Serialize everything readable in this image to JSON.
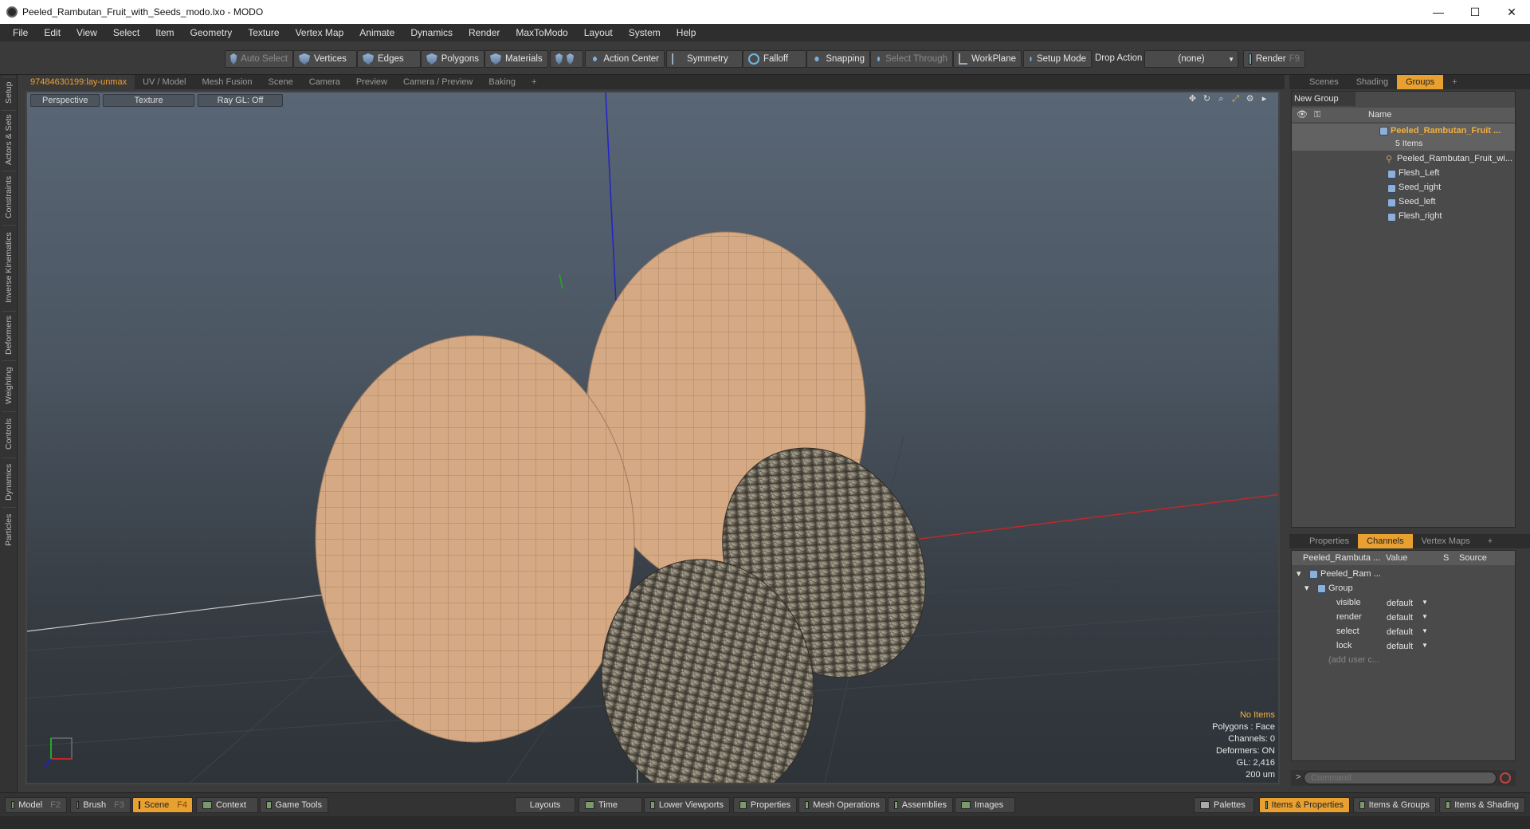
{
  "window": {
    "title": "Peeled_Rambutan_Fruit_with_Seeds_modo.lxo - MODO",
    "minimize": "—",
    "maximize": "☐",
    "close": "✕"
  },
  "menu": [
    "File",
    "Edit",
    "View",
    "Select",
    "Item",
    "Geometry",
    "Texture",
    "Vertex Map",
    "Animate",
    "Dynamics",
    "Render",
    "MaxToModo",
    "Layout",
    "System",
    "Help"
  ],
  "toolbar": {
    "auto_select": "Auto Select",
    "vertices": "Vertices",
    "edges": "Edges",
    "polygons": "Polygons",
    "materials": "Materials",
    "action_center": "Action Center",
    "symmetry": "Symmetry",
    "falloff": "Falloff",
    "snapping": "Snapping",
    "select_through": "Select Through",
    "workplane": "WorkPlane",
    "setup_mode": "Setup Mode",
    "drop_action": "Drop Action",
    "drop_value": "(none)",
    "render": "Render",
    "render_key": "F9"
  },
  "left_tabs": [
    "Setup",
    "Actors & Sets",
    "Constraints",
    "Inverse Kinematics",
    "Deformers",
    "Weighting",
    "Controls",
    "Dynamics",
    "Particles"
  ],
  "viewport_tabs": [
    "97484630199:lay-unmax",
    "UV / Model",
    "Mesh Fusion",
    "Scene",
    "Camera",
    "Preview",
    "Camera / Preview",
    "Baking",
    "+"
  ],
  "viewport": {
    "perspective": "Perspective",
    "texture": "Texture",
    "raygl": "Ray GL: Off"
  },
  "vp_info": {
    "no_items": "No Items",
    "polygons": "Polygons : Face",
    "channels": "Channels: 0",
    "deformers": "Deformers: ON",
    "gl": "GL: 2,416",
    "unit": "200 um"
  },
  "right_tabs": [
    "Scenes",
    "Shading",
    "Groups",
    "+"
  ],
  "groups": {
    "new_group": "New Group",
    "col_name": "Name",
    "root": "Peeled_Rambutan_Fruit ...",
    "count": "5 Items",
    "children": [
      "Peeled_Rambutan_Fruit_wi...",
      "Flesh_Left",
      "Seed_right",
      "Seed_left",
      "Flesh_right"
    ]
  },
  "prop_tabs": [
    "Properties",
    "Channels",
    "Vertex Maps",
    "+"
  ],
  "channels": {
    "col_item": "Peeled_Rambuta ...",
    "col_value": "Value",
    "col_s": "S",
    "col_source": "Source",
    "root": "Peeled_Ram ...",
    "group": "Group",
    "rows": [
      {
        "name": "visible",
        "value": "default"
      },
      {
        "name": "render",
        "value": "default"
      },
      {
        "name": "select",
        "value": "default"
      },
      {
        "name": "lock",
        "value": "default"
      }
    ],
    "add": "(add user c..."
  },
  "command_placeholder": "Command",
  "bottom_left": [
    {
      "label": "Model",
      "key": "F2"
    },
    {
      "label": "Brush",
      "key": "F3"
    },
    {
      "label": "Scene",
      "key": "F4"
    },
    {
      "label": "Context",
      "key": ""
    },
    {
      "label": "Game Tools",
      "key": ""
    }
  ],
  "bottom_mid": [
    "Layouts",
    "Time",
    "Lower Viewports",
    "Properties",
    "Mesh Operations",
    "Assemblies",
    "Images"
  ],
  "bottom_right": [
    "Palettes",
    "Items & Properties",
    "Items & Groups",
    "Items & Shading"
  ],
  "colors": {
    "accent": "#e8a030",
    "flesh": "#d4a983",
    "viewport_top": "#596675",
    "viewport_bottom": "#2e3338"
  }
}
